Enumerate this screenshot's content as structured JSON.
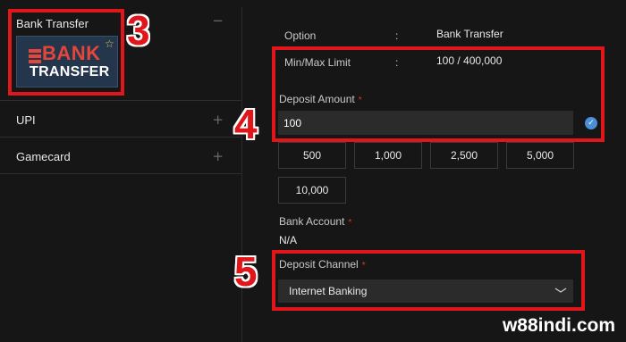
{
  "payment_methods": [
    {
      "label": "Bank Transfer",
      "toggle": "−"
    },
    {
      "label": "UPI",
      "toggle": "+"
    },
    {
      "label": "Gamecard",
      "toggle": "+"
    }
  ],
  "bank_logo": {
    "line1": "BANK",
    "line2": "TRANSFER"
  },
  "details": {
    "option_label": "Option",
    "option_value": "Bank Transfer",
    "limit_label": "Min/Max Limit",
    "limit_value": "100 / 400,000",
    "separator": ":"
  },
  "deposit_amount": {
    "label": "Deposit Amount",
    "required_mark": "*",
    "value": "100"
  },
  "presets": [
    "500",
    "1,000",
    "2,500",
    "5,000",
    "10,000"
  ],
  "bank_account": {
    "label": "Bank Account",
    "required_mark": "*",
    "value": "N/A"
  },
  "deposit_channel": {
    "label": "Deposit Channel",
    "required_mark": "*",
    "selected": "Internet Banking"
  },
  "step_markers": [
    "3",
    "4",
    "5"
  ],
  "watermark": "w88indi.com",
  "colors": {
    "annotation_red": "#e0161b",
    "input_bg": "#2b2b2b",
    "page_bg": "#161616",
    "check_blue": "#4a8fd8"
  }
}
